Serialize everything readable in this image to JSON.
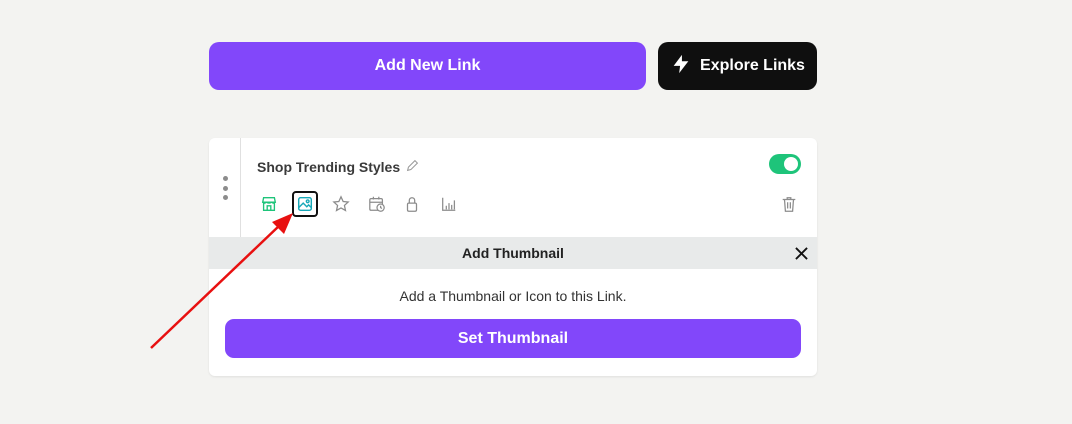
{
  "header": {
    "add_link_label": "Add New Link",
    "explore_label": "Explore Links"
  },
  "link_card": {
    "title": "Shop Trending Styles",
    "enabled": true,
    "toggle_color": "#1ec47a",
    "icons": [
      "store-icon",
      "image-icon",
      "star-icon",
      "schedule-icon",
      "lock-icon",
      "analytics-icon"
    ],
    "active_icon": "image-icon"
  },
  "thumbnail_panel": {
    "title": "Add Thumbnail",
    "description": "Add a Thumbnail or Icon to this Link.",
    "button_label": "Set Thumbnail"
  },
  "colors": {
    "accent": "#8247fa",
    "dark_button": "#0f0f0f",
    "annotation_arrow": "#e81010"
  }
}
